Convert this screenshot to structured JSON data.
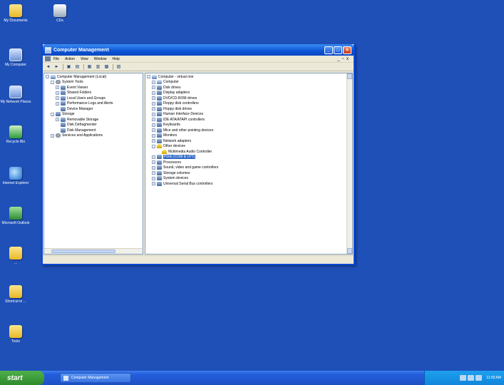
{
  "desktop": {
    "icons": [
      {
        "label": "My Documents",
        "icon": "my-documents-icon"
      },
      {
        "label": "CDs",
        "icon": "network-mapper-icon"
      },
      {
        "label": "My Computer",
        "icon": "my-computer-icon"
      },
      {
        "label": "My Network Places",
        "icon": "network-places-icon"
      },
      {
        "label": "Recycle Bin",
        "icon": "recycle-bin-icon"
      },
      {
        "label": "Internet Explorer",
        "icon": "internet-explorer-icon"
      },
      {
        "label": "Microsoft Outlook",
        "icon": "outlook-icon"
      },
      {
        "label": "...",
        "icon": "folder-icon"
      },
      {
        "label": "Shortcut to ...",
        "icon": "folder-icon"
      },
      {
        "label": "Tools",
        "icon": "folder-icon"
      }
    ]
  },
  "window": {
    "title": "Computer Management",
    "menu": [
      "File",
      "Action",
      "View",
      "Window",
      "Help"
    ],
    "mdi_controls": "_ ▫ x",
    "left_tree": [
      {
        "label": "Computer Management (Local)",
        "level": 0,
        "exp": "-",
        "icon": "computer-management-icon"
      },
      {
        "label": "System Tools",
        "level": 1,
        "exp": "-",
        "icon": "tools-icon"
      },
      {
        "label": "Event Viewer",
        "level": 2,
        "exp": "+",
        "icon": "event-viewer-icon"
      },
      {
        "label": "Shared Folders",
        "level": 2,
        "exp": "+",
        "icon": "shared-folders-icon"
      },
      {
        "label": "Local Users and Groups",
        "level": 2,
        "exp": "+",
        "icon": "users-icon"
      },
      {
        "label": "Performance Logs and Alerts",
        "level": 2,
        "exp": "+",
        "icon": "performance-icon"
      },
      {
        "label": "Device Manager",
        "level": 2,
        "exp": "",
        "icon": "device-manager-icon"
      },
      {
        "label": "Storage",
        "level": 1,
        "exp": "-",
        "icon": "storage-icon"
      },
      {
        "label": "Removable Storage",
        "level": 2,
        "exp": "+",
        "icon": "removable-storage-icon"
      },
      {
        "label": "Disk Defragmenter",
        "level": 2,
        "exp": "",
        "icon": "defragmenter-icon"
      },
      {
        "label": "Disk Management",
        "level": 2,
        "exp": "",
        "icon": "disk-management-icon"
      },
      {
        "label": "Services and Applications",
        "level": 1,
        "exp": "+",
        "icon": "services-icon"
      }
    ],
    "right_tree": [
      {
        "label": "Computer",
        "level": 1,
        "exp": "+",
        "icon": "computer-icon"
      },
      {
        "label": "Disk drives",
        "level": 1,
        "exp": "+",
        "icon": "disk-drive-icon"
      },
      {
        "label": "Display adapters",
        "level": 1,
        "exp": "+",
        "icon": "display-icon"
      },
      {
        "label": "DVD/CD-ROM drives",
        "level": 1,
        "exp": "+",
        "icon": "cdrom-icon"
      },
      {
        "label": "Floppy disk controllers",
        "level": 1,
        "exp": "+",
        "icon": "controller-icon"
      },
      {
        "label": "Floppy disk drives",
        "level": 1,
        "exp": "+",
        "icon": "floppy-icon"
      },
      {
        "label": "Human Interface Devices",
        "level": 1,
        "exp": "+",
        "icon": "hid-icon"
      },
      {
        "label": "IDE ATA/ATAPI controllers",
        "level": 1,
        "exp": "+",
        "icon": "ide-icon"
      },
      {
        "label": "Keyboards",
        "level": 1,
        "exp": "+",
        "icon": "keyboard-icon"
      },
      {
        "label": "Mice and other pointing devices",
        "level": 1,
        "exp": "+",
        "icon": "mouse-icon"
      },
      {
        "label": "Monitors",
        "level": 1,
        "exp": "+",
        "icon": "monitor-icon"
      },
      {
        "label": "Network adapters",
        "level": 1,
        "exp": "+",
        "icon": "network-adapter-icon"
      },
      {
        "label": "Other devices",
        "level": 1,
        "exp": "-",
        "icon": "warning-icon"
      },
      {
        "label": "Multimedia Audio Controller",
        "level": 2,
        "exp": "",
        "icon": "warning-icon"
      },
      {
        "label": "Ports (COM & LPT)",
        "level": 1,
        "exp": "+",
        "icon": "ports-icon",
        "selected": true
      },
      {
        "label": "Processors",
        "level": 1,
        "exp": "+",
        "icon": "processor-icon"
      },
      {
        "label": "Sound, video and game controllers",
        "level": 1,
        "exp": "+",
        "icon": "sound-icon"
      },
      {
        "label": "Storage volumes",
        "level": 1,
        "exp": "+",
        "icon": "storage-volume-icon"
      },
      {
        "label": "System devices",
        "level": 1,
        "exp": "+",
        "icon": "system-devices-icon"
      },
      {
        "label": "Universal Serial Bus controllers",
        "level": 1,
        "exp": "+",
        "icon": "usb-icon"
      }
    ],
    "root_label": "Computer - virtual one"
  },
  "taskbar": {
    "start_label": "start",
    "task_label": "Computer Management",
    "clock": "11:59 AM"
  }
}
